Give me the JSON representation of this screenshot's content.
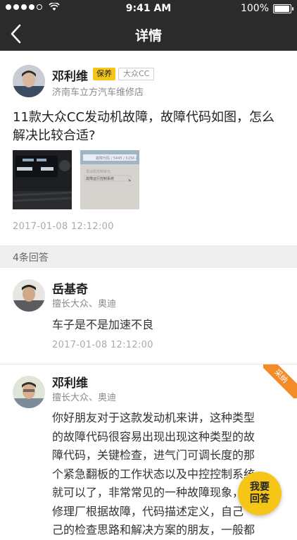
{
  "status_bar": {
    "time": "9:41 AM",
    "battery": "100%"
  },
  "nav": {
    "title": "详情"
  },
  "post": {
    "author": "邓利维",
    "tag_service": "保养",
    "tag_car": "大众CC",
    "shop": "济南车立方汽车维修店",
    "question": "11款大众CC发动机故障，故障代码如图，怎么解决比较合适?",
    "time": "2017-01-08 12:12:00",
    "image2_lines": [
      "故障代码 / 5445 / 5156 /",
      "发动机控制单元",
      "故障运行控制系统"
    ]
  },
  "answers_header": "4条回答",
  "answers": [
    {
      "author": "岳基奇",
      "expertise": "擅长大众、奥迪",
      "content": "车子是不是加速不良",
      "time": "2017-01-08 12:12:00"
    },
    {
      "author": "邓利维",
      "expertise": "擅长大众、奥迪",
      "accepted_badge": "采纳",
      "content_lines": [
        "你好朋友对于这款发动机来讲，这种类型",
        "的故障代码很容易出现出现这种类型的故",
        "障代码，关键检查，进气门可调长度的那",
        "个紧急翻板的工作状态以及中控控制系统",
        "就可以了，非常常见的一种故障现象，",
        "修理厂根据故障，代码描述定义，自己",
        "己的检查思路和解决方案的朋友，一般都"
      ]
    }
  ],
  "fab": {
    "line1": "我要",
    "line2": "回答"
  },
  "colors": {
    "nav_bg": "#2b2b2b",
    "accent_yellow": "#f5c518",
    "badge_orange": "#f38b27"
  }
}
